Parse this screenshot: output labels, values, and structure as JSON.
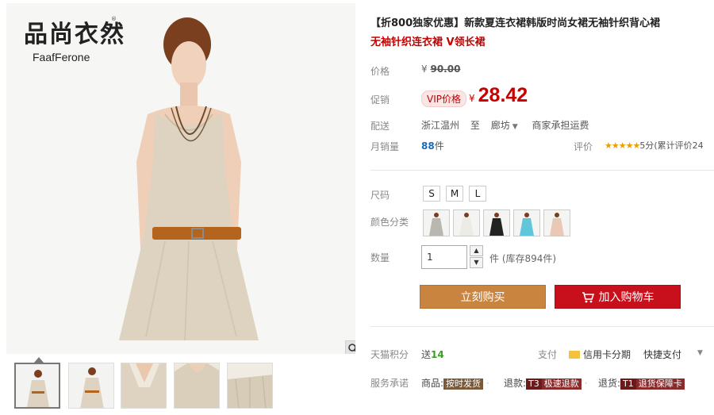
{
  "brand": {
    "logo_cn": "品尚衣然",
    "logo_tm": "®",
    "logo_en": "FaafFerone"
  },
  "gallery": {
    "zoom_icon": "magnifier-icon",
    "thumbs": [
      "thumb-1",
      "thumb-2",
      "thumb-3",
      "thumb-4",
      "thumb-5"
    ]
  },
  "product": {
    "title": "【折800独家优惠】新款夏连衣裙韩版时尚女裙无袖针织背心裙",
    "subtitle": "无袖针织连衣裙 V领长裙"
  },
  "price": {
    "label": "价格",
    "currency": "¥",
    "original": "90.00"
  },
  "promo": {
    "label": "促销",
    "badge": "VIP价格",
    "currency": "¥",
    "value": "28.42"
  },
  "shipping": {
    "label": "配送",
    "from": "浙江温州",
    "to_word": "至",
    "dest": "廊坊",
    "fee": "商家承担运费"
  },
  "sales": {
    "label": "月销量",
    "count": "88",
    "unit": "件"
  },
  "rating": {
    "label": "评价",
    "stars": "★★★★★",
    "score": "5分",
    "count_text": "(累计评价24"
  },
  "size": {
    "label": "尺码",
    "options": [
      "S",
      "M",
      "L"
    ]
  },
  "color": {
    "label": "颜色分类",
    "swatches": [
      "beige",
      "white",
      "black",
      "light-blue",
      "pink"
    ]
  },
  "quantity": {
    "label": "数量",
    "value": "1",
    "unit": "件",
    "stock": "(库存894件)"
  },
  "actions": {
    "buy_now": "立刻购买",
    "add_to_cart": "加入购物车"
  },
  "points": {
    "label": "天猫积分",
    "prefix": "送",
    "value": "14"
  },
  "payment": {
    "label": "支付",
    "card": "信用卡分期",
    "quick": "快捷支付"
  },
  "service": {
    "label": "服务承诺",
    "item1_prefix": "商品:",
    "item1_tag": "按时发货",
    "item2_prefix": "退款:",
    "item2_tag1": "T3",
    "item2_tag2": "极速退款",
    "item3_prefix": "退货:",
    "item3_tag1": "T1",
    "item3_tag2": "退货保障卡"
  },
  "colors": {
    "accent_red": "#c40000",
    "buy_button": "#c9853f",
    "cart_button": "#c8101c"
  }
}
